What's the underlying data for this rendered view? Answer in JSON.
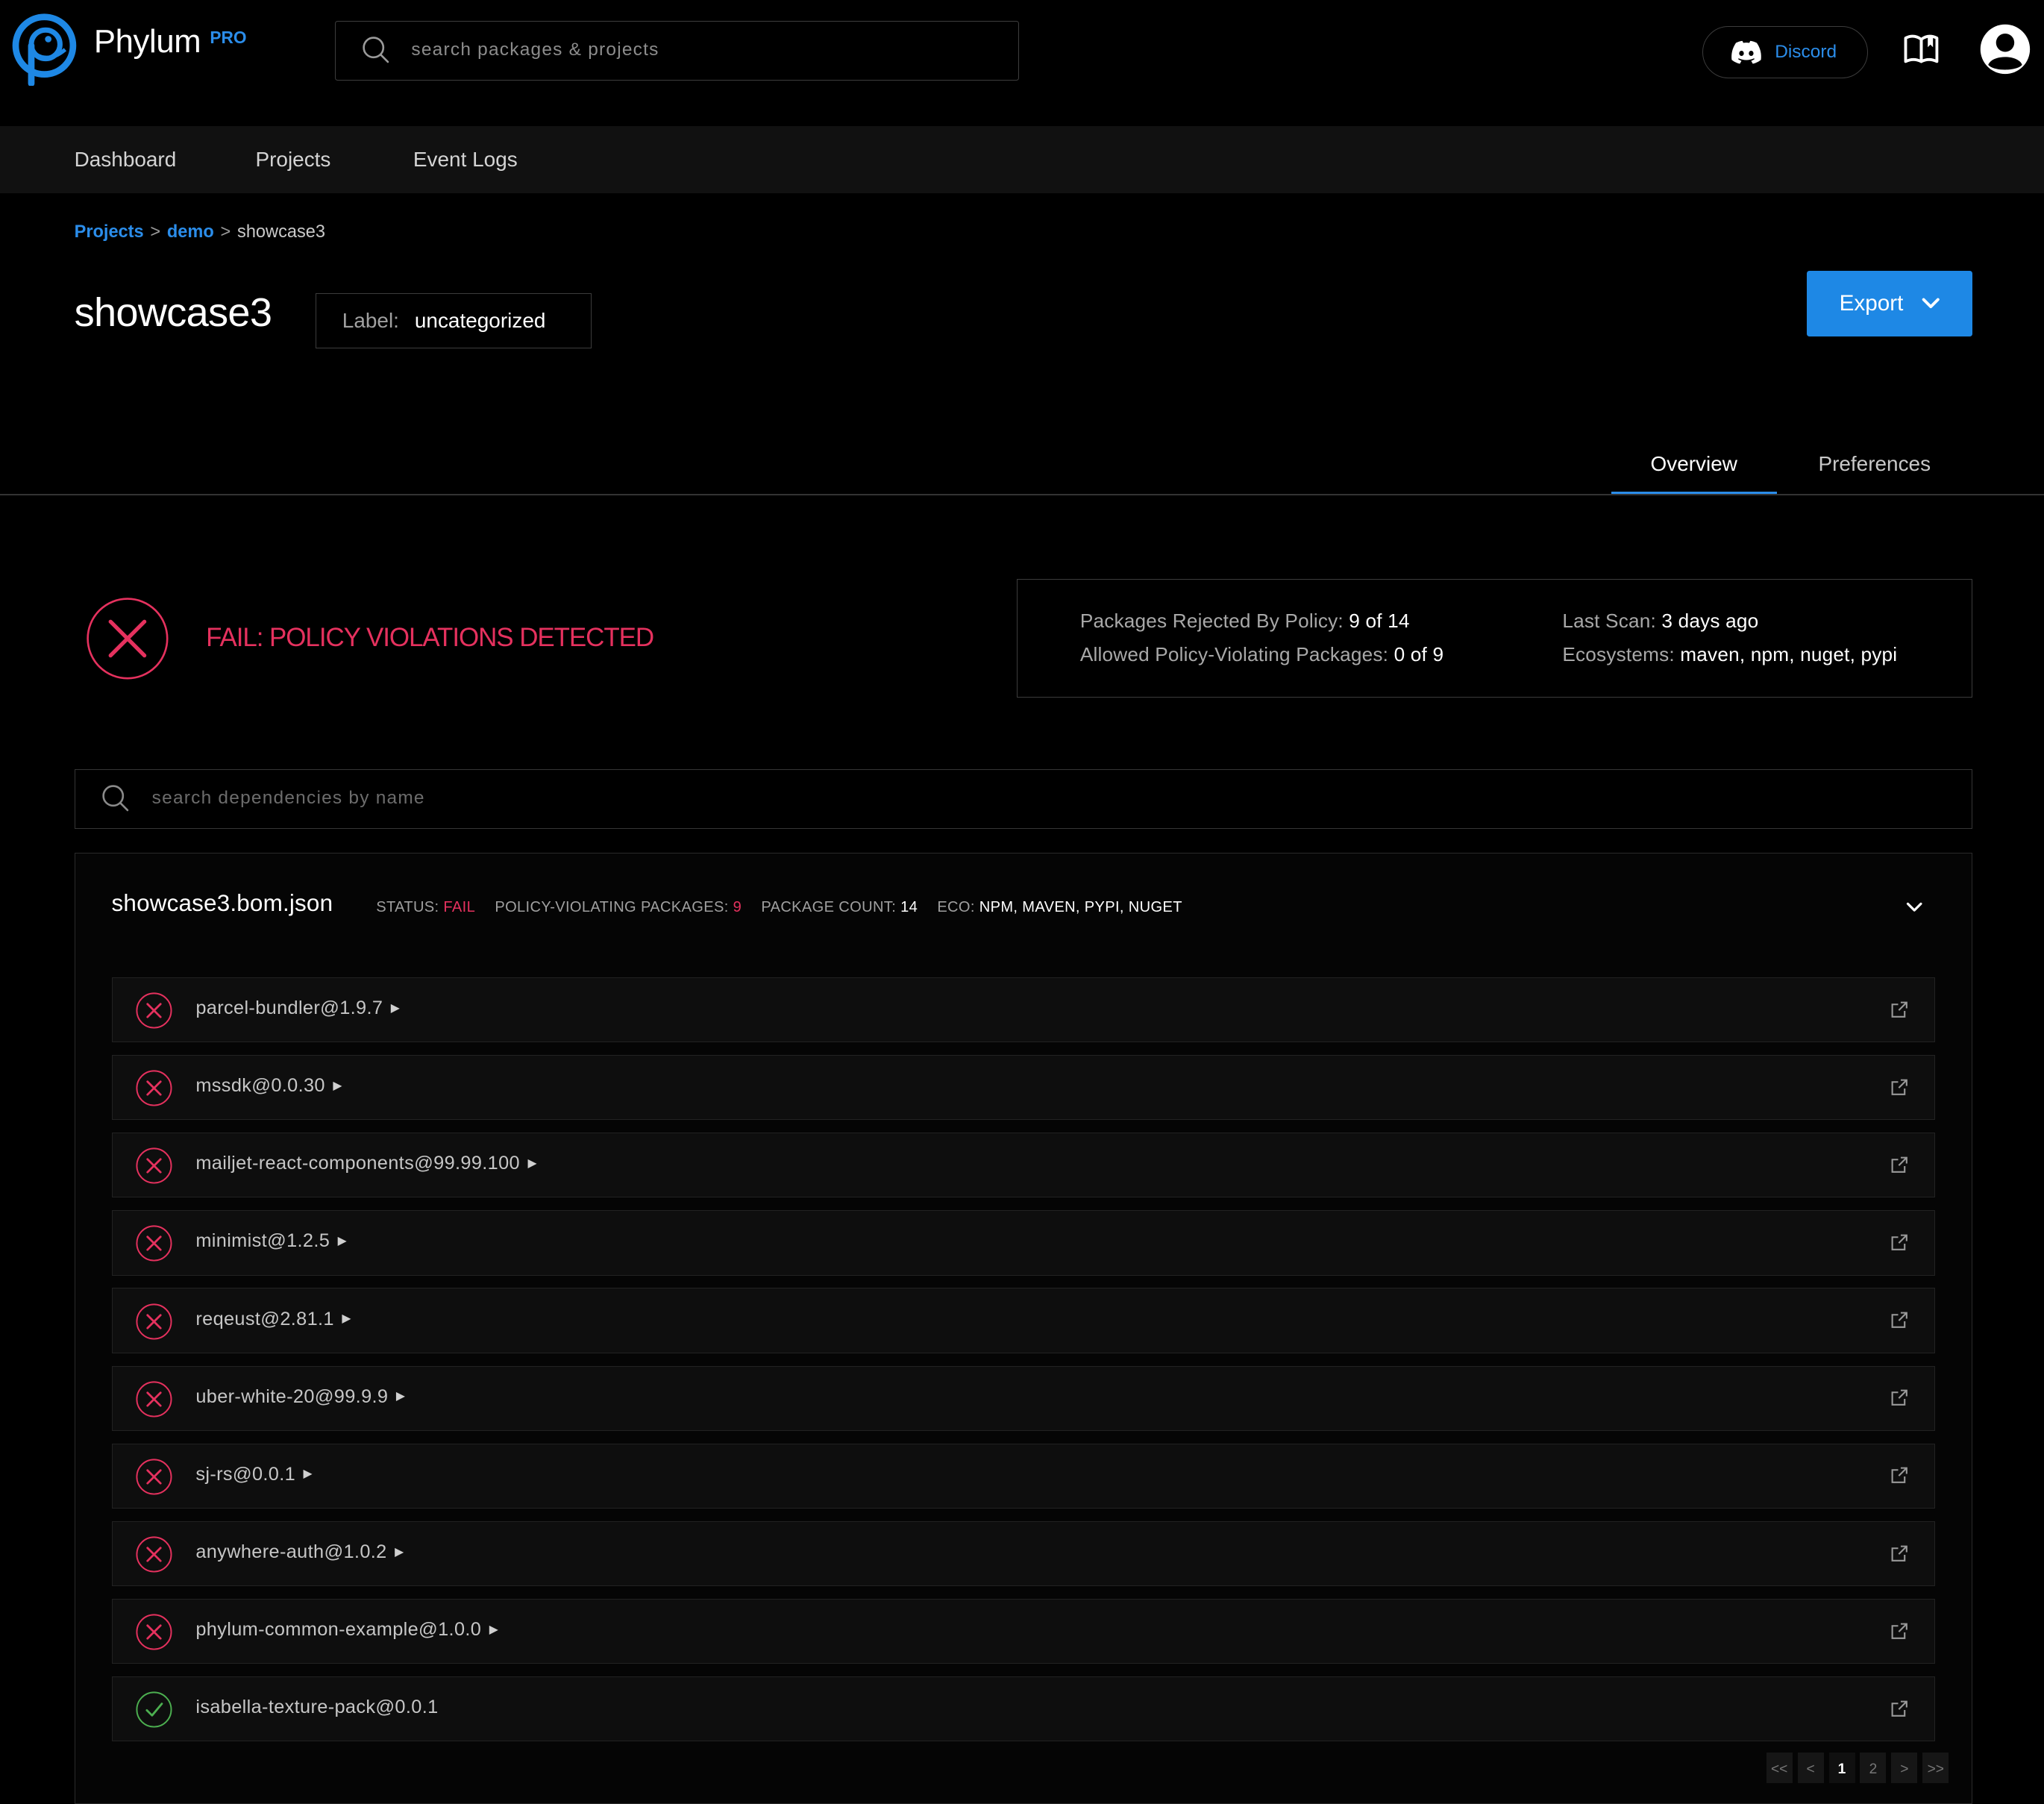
{
  "brand": {
    "name": "Phylum",
    "tier": "PRO"
  },
  "top_search": {
    "placeholder": "search packages & projects"
  },
  "discord": {
    "label": "Discord"
  },
  "nav": {
    "items": [
      "Dashboard",
      "Projects",
      "Event Logs"
    ]
  },
  "breadcrumb": {
    "projects": "Projects",
    "sep1": ">",
    "group": "demo",
    "sep2": ">",
    "current": "showcase3"
  },
  "project": {
    "title": "showcase3",
    "label_key": "Label:",
    "label_value": "uncategorized",
    "export_label": "Export"
  },
  "tabs": [
    "Overview",
    "Preferences"
  ],
  "status": {
    "result": "FAIL: POLICY VIOLATIONS DETECTED",
    "rejected_label": "Packages Rejected By Policy:",
    "rejected_value": "9 of 14",
    "allowed_label": "Allowed Policy-Violating Packages:",
    "allowed_value": "0 of 9",
    "last_scan_label": "Last Scan:",
    "last_scan_value": "3 days ago",
    "ecosystems_label": "Ecosystems:",
    "ecosystems_value": "maven, npm, nuget, pypi"
  },
  "dep_search": {
    "placeholder": "search dependencies by name"
  },
  "file": {
    "name": "showcase3.bom.json",
    "status_label": "STATUS:",
    "status_value": "FAIL",
    "violating_label": "POLICY-VIOLATING PACKAGES:",
    "violating_value": "9",
    "count_label": "PACKAGE COUNT:",
    "count_value": "14",
    "eco_label": "ECO:",
    "eco_value": "NPM, MAVEN, PYPI, NUGET"
  },
  "packages": [
    {
      "name": "parcel-bundler@1.9.7",
      "status": "fail",
      "expandable": true
    },
    {
      "name": "mssdk@0.0.30",
      "status": "fail",
      "expandable": true
    },
    {
      "name": "mailjet-react-components@99.99.100",
      "status": "fail",
      "expandable": true
    },
    {
      "name": "minimist@1.2.5",
      "status": "fail",
      "expandable": true
    },
    {
      "name": "reqeust@2.81.1",
      "status": "fail",
      "expandable": true
    },
    {
      "name": "uber-white-20@99.9.9",
      "status": "fail",
      "expandable": true
    },
    {
      "name": "sj-rs@0.0.1",
      "status": "fail",
      "expandable": true
    },
    {
      "name": "anywhere-auth@1.0.2",
      "status": "fail",
      "expandable": true
    },
    {
      "name": "phylum-common-example@1.0.0",
      "status": "fail",
      "expandable": true
    },
    {
      "name": "isabella-texture-pack@0.0.1",
      "status": "pass",
      "expandable": false
    }
  ],
  "pagination": {
    "first": "<<",
    "prev": "<",
    "pages": [
      "1",
      "2"
    ],
    "current": "1",
    "next": ">",
    "last": ">>"
  },
  "colors": {
    "accent": "#2b8dea",
    "fail": "#e5315e",
    "pass": "#4caf50",
    "export": "#1e88e5"
  }
}
